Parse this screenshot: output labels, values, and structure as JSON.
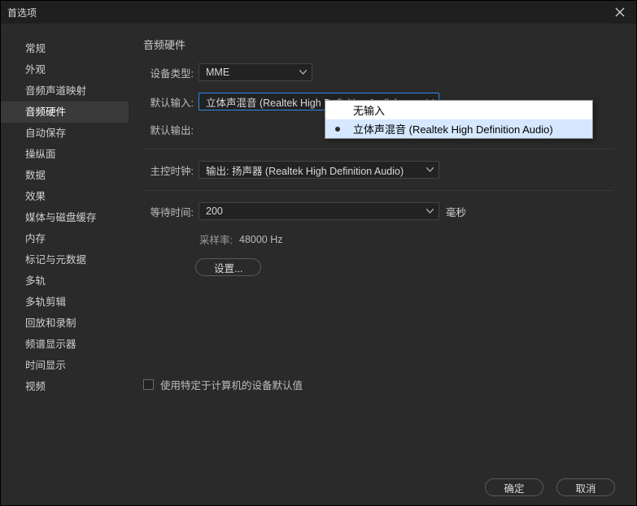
{
  "window": {
    "title": "首选项"
  },
  "sidebar": {
    "items": [
      {
        "label": "常规"
      },
      {
        "label": "外观"
      },
      {
        "label": "音频声道映射"
      },
      {
        "label": "音频硬件"
      },
      {
        "label": "自动保存"
      },
      {
        "label": "操纵面"
      },
      {
        "label": "数据"
      },
      {
        "label": "效果"
      },
      {
        "label": "媒体与磁盘缓存"
      },
      {
        "label": "内存"
      },
      {
        "label": "标记与元数据"
      },
      {
        "label": "多轨"
      },
      {
        "label": "多轨剪辑"
      },
      {
        "label": "回放和录制"
      },
      {
        "label": "频谱显示器"
      },
      {
        "label": "时间显示"
      },
      {
        "label": "视频"
      }
    ],
    "active_index": 3
  },
  "main": {
    "heading": "音频硬件",
    "device_class_label": "设备类型:",
    "device_class_value": "MME",
    "default_input_label": "默认输入:",
    "default_input_value": "立体声混音 (Realtek High Definition Audio)",
    "dropdown": {
      "options": [
        {
          "label": "无输入",
          "selected": false
        },
        {
          "label": "立体声混音 (Realtek High Definition Audio)",
          "selected": true
        }
      ]
    },
    "default_output_label": "默认输出:",
    "master_clock_label": "主控时钟:",
    "master_clock_value": "输出: 扬声器 (Realtek High Definition Audio)",
    "latency_label": "等待时间:",
    "latency_value": "200",
    "latency_unit": "毫秒",
    "sample_rate_label": "采样率:",
    "sample_rate_value": "48000 Hz",
    "settings_button": "设置...",
    "machine_defaults_label": "使用特定于计算机的设备默认值"
  },
  "footer": {
    "ok": "确定",
    "cancel": "取消"
  }
}
